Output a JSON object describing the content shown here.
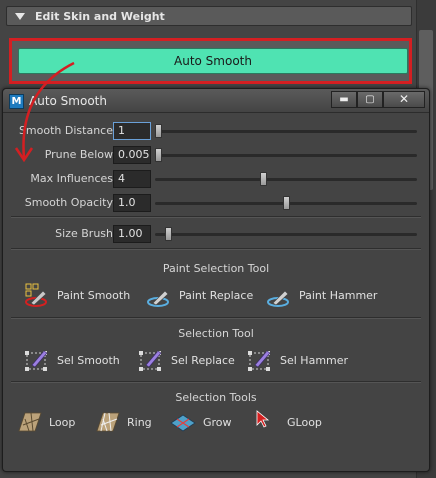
{
  "panel": {
    "header_title": "Edit Skin and Weight",
    "auto_smooth_button": "Auto Smooth"
  },
  "dialog": {
    "app_icon_letter": "M",
    "title": "Auto Smooth",
    "minimize": "▬",
    "maximize": "▢",
    "close": "✕"
  },
  "fields": [
    {
      "label": "Smooth Distance",
      "value": "1",
      "slider_fraction": 0.0
    },
    {
      "label": "Prune Below",
      "value": "0.005",
      "slider_fraction": 0.0
    },
    {
      "label": "Max Influences",
      "value": "4",
      "slider_fraction": 0.41
    },
    {
      "label": "Smooth Opacity",
      "value": "1.0",
      "slider_fraction": 0.5
    }
  ],
  "size_brush": {
    "label": "Size Brush",
    "value": "1.00",
    "slider_fraction": 0.04
  },
  "sections": {
    "paint_selection": {
      "title": "Paint Selection Tool",
      "tools": [
        "Paint Smooth",
        "Paint Replace",
        "Paint Hammer"
      ]
    },
    "selection_tool": {
      "title": "Selection Tool",
      "tools": [
        "Sel Smooth",
        "Sel Replace",
        "Sel Hammer"
      ]
    },
    "selection_tools": {
      "title": "Selection Tools",
      "tools": [
        "Loop",
        "Ring",
        "Grow",
        "GLoop"
      ]
    }
  },
  "colors": {
    "accent_button": "#4fe3b2",
    "highlight_frame": "#d41f22",
    "annotation_arrow": "#d41f22"
  }
}
